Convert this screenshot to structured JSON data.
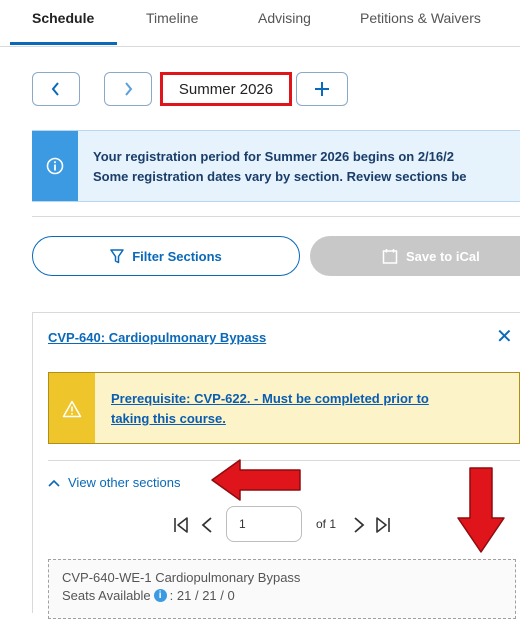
{
  "tabs": [
    {
      "label": "Schedule",
      "active": true
    },
    {
      "label": "Timeline",
      "active": false
    },
    {
      "label": "Advising",
      "active": false
    },
    {
      "label": "Petitions & Waivers",
      "active": false
    }
  ],
  "term_nav": {
    "prev_icon": "chevron-left-icon",
    "next_icon": "chevron-right-icon",
    "term": "Summer 2026",
    "add_icon": "plus-icon"
  },
  "info_banner": {
    "icon": "info-icon",
    "line1": "Your registration period for Summer 2026 begins on 2/16/2",
    "line2": "Some registration dates vary by section. Review sections be"
  },
  "actions": {
    "filter_label": "Filter Sections",
    "filter_icon": "filter-icon",
    "ical_label": "Save to iCal",
    "ical_icon": "calendar-icon"
  },
  "course": {
    "title": "CVP-640: Cardiopulmonary Bypass",
    "close_label": "✕",
    "prereq_line1": "Prerequisite: CVP-622. - Must be completed prior to",
    "prereq_line2": "taking this course.",
    "view_other_label": "View other sections"
  },
  "pager": {
    "page_value": "1",
    "of_label": "of 1"
  },
  "section": {
    "title": "CVP-640-WE-1 Cardiopulmonary Bypass",
    "seats_label": "Seats Available",
    "seats_value": ": 21 / 21 / 0"
  },
  "colors": {
    "accent": "#0a69b8",
    "highlight_box": "#e0141b",
    "annotation_arrow": "#e0141b",
    "info_side": "#3b9ae1",
    "warning_side": "#eec52a"
  }
}
